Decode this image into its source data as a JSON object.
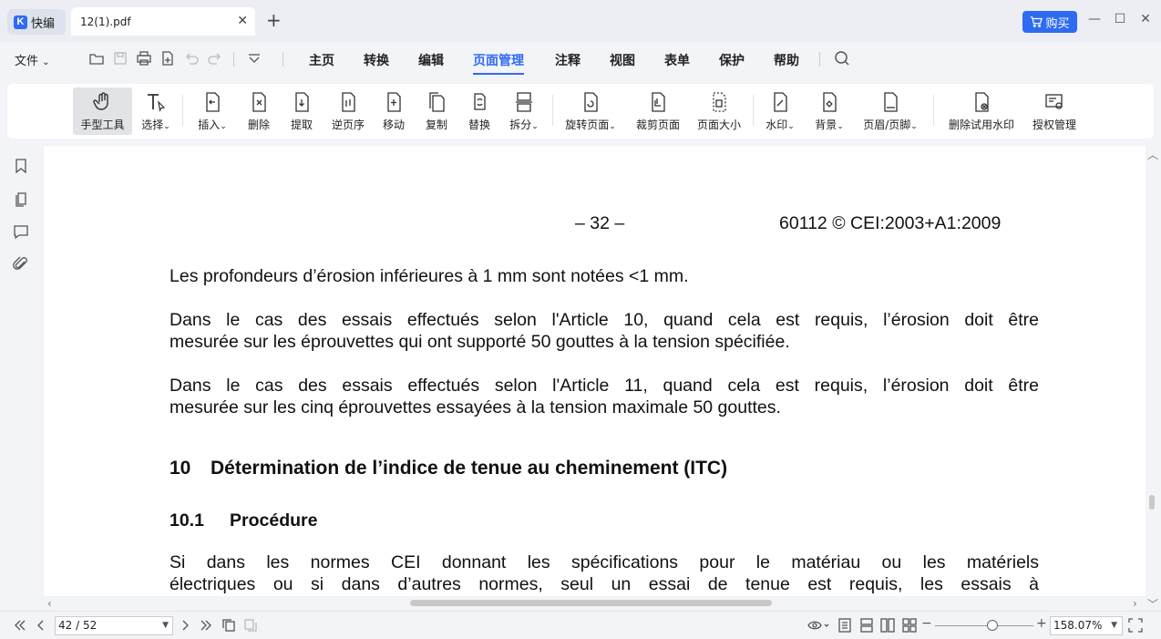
{
  "app": {
    "name": "快编",
    "tab_title": "12(1).pdf",
    "buy_label": "购买"
  },
  "menu": {
    "file_label": "文件",
    "items": [
      {
        "label": "主页"
      },
      {
        "label": "转换"
      },
      {
        "label": "编辑"
      },
      {
        "label": "页面管理"
      },
      {
        "label": "注释"
      },
      {
        "label": "视图"
      },
      {
        "label": "表单"
      },
      {
        "label": "保护"
      },
      {
        "label": "帮助"
      }
    ],
    "active": "页面管理"
  },
  "ribbon": {
    "tools": [
      {
        "label": "手型工具",
        "icon": "hand-icon"
      },
      {
        "label": "选择",
        "icon": "select-text-icon",
        "dropdown": true
      },
      {
        "label": "插入",
        "icon": "insert-page-icon",
        "dropdown": true
      },
      {
        "label": "删除",
        "icon": "delete-page-icon"
      },
      {
        "label": "提取",
        "icon": "extract-page-icon"
      },
      {
        "label": "逆页序",
        "icon": "reverse-order-icon"
      },
      {
        "label": "移动",
        "icon": "move-page-icon"
      },
      {
        "label": "复制",
        "icon": "copy-page-icon"
      },
      {
        "label": "替换",
        "icon": "replace-page-icon"
      },
      {
        "label": "拆分",
        "icon": "split-page-icon",
        "dropdown": true
      },
      {
        "label": "旋转页面",
        "icon": "rotate-page-icon",
        "dropdown": true
      },
      {
        "label": "裁剪页面",
        "icon": "crop-page-icon"
      },
      {
        "label": "页面大小",
        "icon": "page-size-icon"
      },
      {
        "label": "水印",
        "icon": "watermark-icon",
        "dropdown": true
      },
      {
        "label": "背景",
        "icon": "background-icon",
        "dropdown": true
      },
      {
        "label": "页眉/页脚",
        "icon": "header-footer-icon",
        "dropdown": true
      },
      {
        "label": "删除试用水印",
        "icon": "remove-watermark-icon"
      },
      {
        "label": "授权管理",
        "icon": "license-icon"
      }
    ]
  },
  "document": {
    "page_number_header": "– 32 –",
    "standard_ref": "60112 © CEI:2003+A1:2009",
    "para1": "Les profondeurs d’érosion inférieures à 1 mm sont notées <1 mm.",
    "para2_line1": "Dans le cas des essais effectués selon l'Article 10, quand cela est requis, l’érosion doit être",
    "para2_line2": "mesurée sur les éprouvettes qui ont supporté 50 gouttes à la tension spécifiée.",
    "para3_line1": "Dans le cas des essais effectués selon l'Article 11, quand cela est requis, l’érosion doit être",
    "para3_line2": "mesurée sur les cinq éprouvettes essayées à la tension maximale 50 gouttes.",
    "heading_num": "10",
    "heading_text": "Détermination de l’indice de tenue au cheminement (ITC)",
    "subheading_num": "10.1",
    "subheading_text": "Procédure",
    "para4_line1": "Si dans les normes CEI donnant les spécifications pour le matériau ou les matériels",
    "para4_line2": "électriques ou si dans d’autres normes, seul un essai de tenue est requis, les essais à"
  },
  "status": {
    "page_indicator": "42 / 52",
    "zoom": "158.07%",
    "zoom_level_fraction": 0.53
  }
}
